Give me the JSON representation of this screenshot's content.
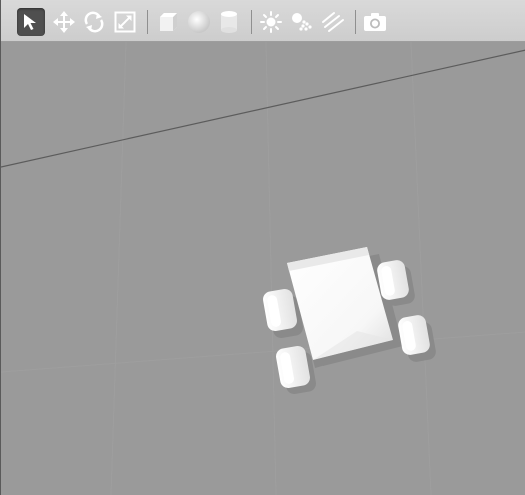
{
  "toolbar": {
    "tools": [
      {
        "id": "select",
        "icon": "select-arrow-icon",
        "active": true
      },
      {
        "id": "translate",
        "icon": "translate-icon"
      },
      {
        "id": "rotate",
        "icon": "rotate-icon"
      },
      {
        "id": "scale",
        "icon": "scale-icon"
      },
      {
        "id": "box",
        "icon": "box-shape-icon"
      },
      {
        "id": "sphere",
        "icon": "sphere-shape-icon"
      },
      {
        "id": "cylinder",
        "icon": "cylinder-shape-icon"
      },
      {
        "id": "point-light",
        "icon": "point-light-icon"
      },
      {
        "id": "spot-light",
        "icon": "spot-light-icon"
      },
      {
        "id": "directional-light",
        "icon": "directional-light-icon"
      },
      {
        "id": "screenshot",
        "icon": "camera-icon"
      }
    ]
  },
  "scene": {
    "background": "#9a9a9a",
    "model": "four-wheeled-robot"
  }
}
